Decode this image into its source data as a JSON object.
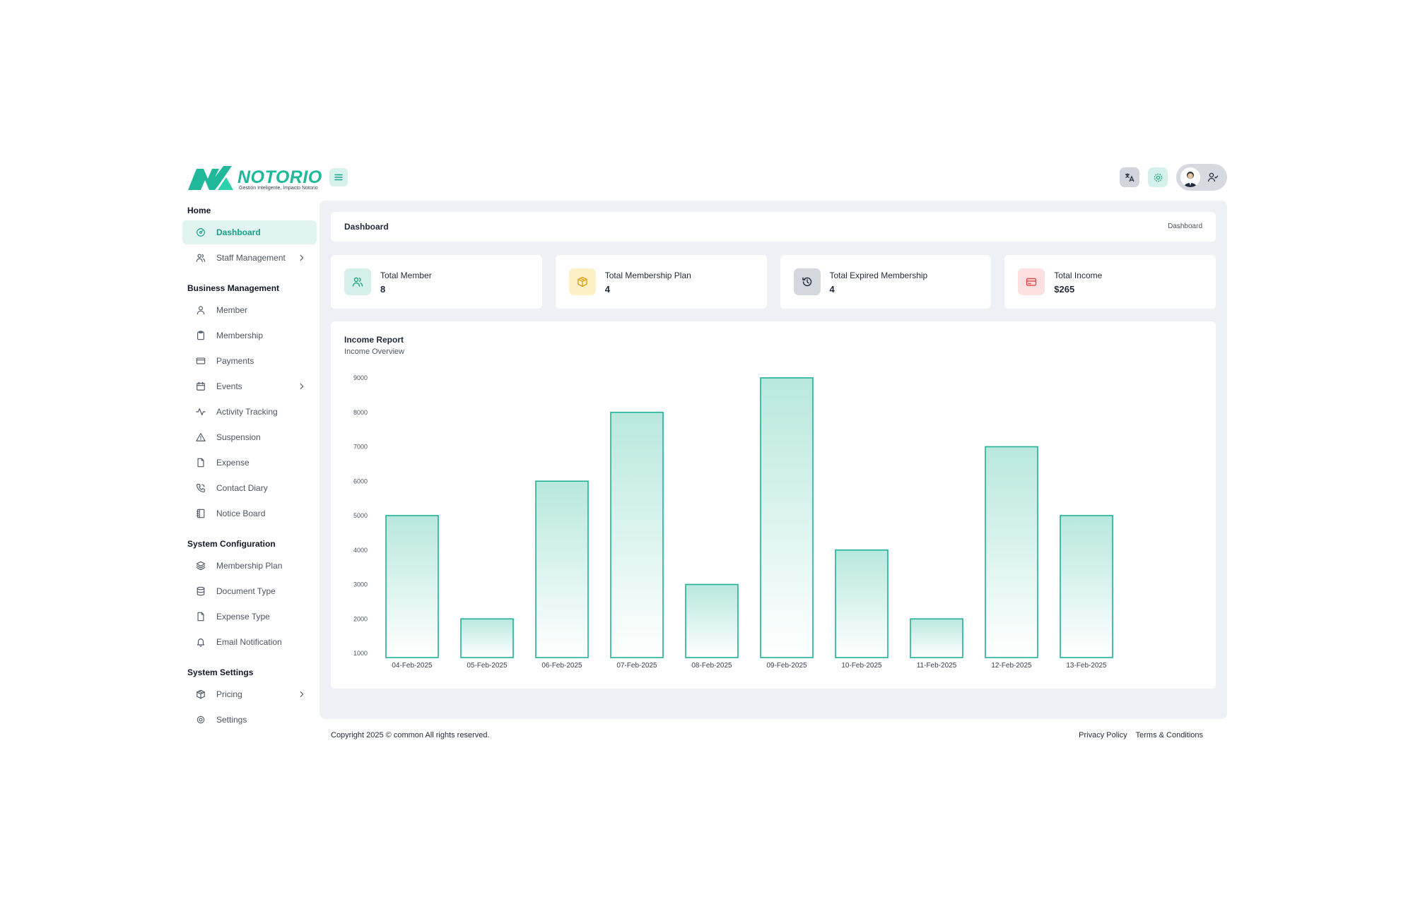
{
  "brand": {
    "name": "NOTORIO",
    "tagline": "Gestión Inteligente, Impacto Notorio"
  },
  "colors": {
    "accent": "#1fb89a",
    "bar_stroke": "#20b095",
    "bar_fill_top": "#b8e8de"
  },
  "sidebar": {
    "sections": [
      {
        "title": "Home",
        "items": [
          {
            "label": "Dashboard",
            "icon": "dashboard-icon",
            "active": true
          },
          {
            "label": "Staff Management",
            "icon": "users-icon",
            "chevron": true
          }
        ]
      },
      {
        "title": "Business Management",
        "items": [
          {
            "label": "Member",
            "icon": "user-icon"
          },
          {
            "label": "Membership",
            "icon": "clipboard-icon"
          },
          {
            "label": "Payments",
            "icon": "credit-card-icon"
          },
          {
            "label": "Events",
            "icon": "calendar-icon",
            "chevron": true
          },
          {
            "label": "Activity Tracking",
            "icon": "activity-icon"
          },
          {
            "label": "Suspension",
            "icon": "alert-triangle-icon"
          },
          {
            "label": "Expense",
            "icon": "file-icon"
          },
          {
            "label": "Contact Diary",
            "icon": "phone-icon"
          },
          {
            "label": "Notice Board",
            "icon": "notebook-icon"
          }
        ]
      },
      {
        "title": "System Configuration",
        "items": [
          {
            "label": "Membership Plan",
            "icon": "layers-icon"
          },
          {
            "label": "Document Type",
            "icon": "database-icon"
          },
          {
            "label": "Expense Type",
            "icon": "file-icon"
          },
          {
            "label": "Email Notification",
            "icon": "bell-icon"
          }
        ]
      },
      {
        "title": "System Settings",
        "items": [
          {
            "label": "Pricing",
            "icon": "package-icon",
            "chevron": true
          },
          {
            "label": "Settings",
            "icon": "gear-icon"
          }
        ]
      }
    ]
  },
  "breadcrumb": {
    "title": "Dashboard",
    "current": "Dashboard"
  },
  "stats": [
    {
      "label": "Total Member",
      "value": "8",
      "icon": "users-icon",
      "bg": "#d5f0ea",
      "color": "#1fa388"
    },
    {
      "label": "Total Membership Plan",
      "value": "4",
      "icon": "package-icon",
      "bg": "#fdf0c7",
      "color": "#e0a318"
    },
    {
      "label": "Total Expired Membership",
      "value": "4",
      "icon": "history-icon",
      "bg": "#d4d8de",
      "color": "#1f2937"
    },
    {
      "label": "Total Income",
      "value": "$265",
      "icon": "wallet-icon",
      "bg": "#fde0e0",
      "color": "#e54b4b"
    }
  ],
  "income_report": {
    "title": "Income Report",
    "subtitle": "Income Overview"
  },
  "chart_data": {
    "type": "bar",
    "categories": [
      "04-Feb-2025",
      "05-Feb-2025",
      "06-Feb-2025",
      "07-Feb-2025",
      "08-Feb-2025",
      "09-Feb-2025",
      "10-Feb-2025",
      "11-Feb-2025",
      "12-Feb-2025",
      "13-Feb-2025"
    ],
    "values": [
      5000,
      2000,
      6000,
      8000,
      3000,
      9000,
      4000,
      2000,
      7000,
      5000
    ],
    "yticks": [
      "1000",
      "2000",
      "3000",
      "4000",
      "5000",
      "6000",
      "7000",
      "8000",
      "9000"
    ],
    "ylim": [
      1000,
      9000
    ],
    "title": "",
    "xlabel": "",
    "ylabel": ""
  },
  "footer": {
    "copyright": "Copyright 2025 © common All rights reserved.",
    "privacy": "Privacy Policy",
    "terms": "Terms & Conditions"
  }
}
